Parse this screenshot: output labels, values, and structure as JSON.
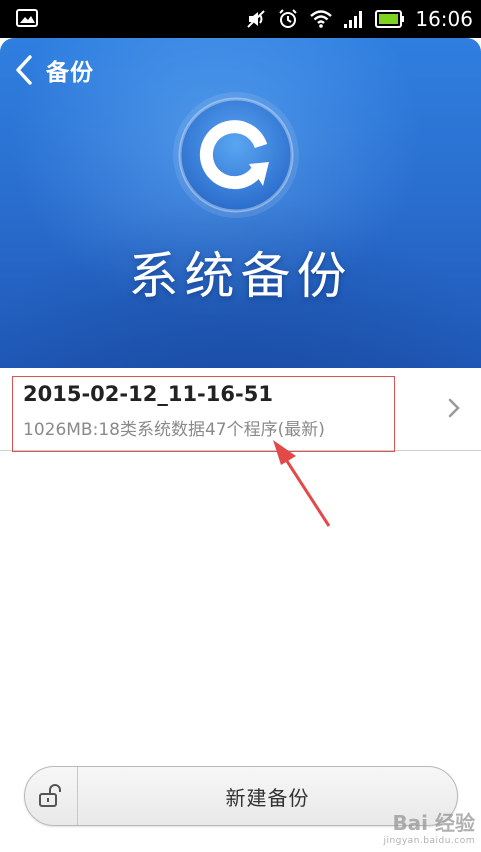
{
  "status_bar": {
    "time": "16:06",
    "icons": [
      "image-notification-icon",
      "mute-icon",
      "alarm-icon",
      "wifi-icon",
      "signal-icon",
      "battery-icon"
    ],
    "battery_color": "#7ed321"
  },
  "header": {
    "back_label": "备份"
  },
  "hero": {
    "title": "系统备份",
    "gradient_top": "#2f7fe0",
    "gradient_bottom": "#1f58b6"
  },
  "backup_list": [
    {
      "name": "2015-02-12_11-16-51",
      "description": "1026MB:18类系统数据47个程序(最新)"
    }
  ],
  "bottom_bar": {
    "new_backup_label": "新建备份"
  },
  "annotation": {
    "highlight_color": "#d9534f",
    "arrow_color": "#e24a4a"
  },
  "watermark": {
    "main": "Bai 经验",
    "sub": "jingyan.baidu.com"
  }
}
